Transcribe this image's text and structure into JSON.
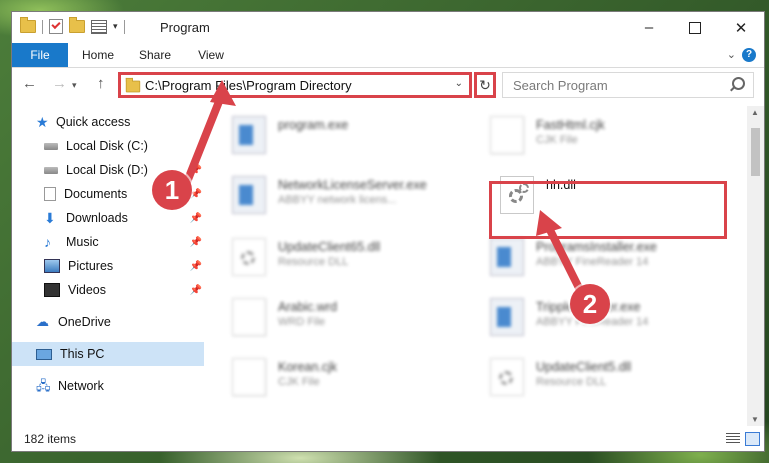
{
  "window": {
    "title": "Program",
    "tabs": {
      "file": "File",
      "home": "Home",
      "share": "Share",
      "view": "View"
    },
    "help": "?"
  },
  "address": {
    "path": "C:\\Program Files\\Program Directory",
    "search_placeholder": "Search Program"
  },
  "nav": {
    "items": [
      {
        "label": "Quick access",
        "icon": "star-icon"
      },
      {
        "label": "Local Disk (C:)",
        "icon": "drive-icon"
      },
      {
        "label": "Local Disk (D:)",
        "icon": "drive-icon"
      },
      {
        "label": "Documents",
        "icon": "documents-icon"
      },
      {
        "label": "Downloads",
        "icon": "downloads-icon"
      },
      {
        "label": "Music",
        "icon": "music-icon"
      },
      {
        "label": "Pictures",
        "icon": "pictures-icon"
      },
      {
        "label": "Videos",
        "icon": "videos-icon"
      },
      {
        "label": "OneDrive",
        "icon": "cloud-icon"
      },
      {
        "label": "This PC",
        "icon": "pc-icon"
      },
      {
        "label": "Network",
        "icon": "network-icon"
      }
    ]
  },
  "files": [
    {
      "name": "program.exe",
      "desc": ""
    },
    {
      "name": "FastHtml.cjk",
      "desc": "CJK File"
    },
    {
      "name": "NetworkLicenseServer.exe",
      "desc": "ABBYY network licens..."
    },
    {
      "name": "hh.dll",
      "desc": ""
    },
    {
      "name": "UpdateClient65.dll",
      "desc": "Resource DLL"
    },
    {
      "name": "ProgramsInstaller.exe",
      "desc": "ABBYY FineReader 14"
    },
    {
      "name": "Arabic.wrd",
      "desc": "WRD File"
    },
    {
      "name": "TrippleInstaller.exe",
      "desc": "ABBYY FineReader 14"
    },
    {
      "name": "Korean.cjk",
      "desc": "CJK File"
    },
    {
      "name": "UpdateClient5.dll",
      "desc": "Resource DLL"
    }
  ],
  "status": {
    "count": "182 items"
  },
  "markers": {
    "one": "1",
    "two": "2"
  },
  "colors": {
    "accent": "#1979ca",
    "highlight": "#d9434a"
  }
}
